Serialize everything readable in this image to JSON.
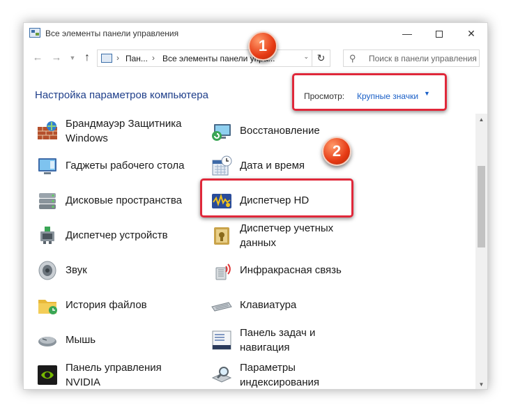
{
  "window": {
    "title": "Все элементы панели управления"
  },
  "nav": {
    "back_icon": "arrow-left-icon",
    "crumbs": [
      "Пан...",
      "Все элементы панели упра..."
    ],
    "search_placeholder": "Поиск в панели управления"
  },
  "header": {
    "title": "Настройка параметров компьютера",
    "view_label": "Просмотр:",
    "view_value": "Крупные значки"
  },
  "badges": [
    "1",
    "2"
  ],
  "items": [
    {
      "label1": "Брандмауэр Защитника",
      "label2": "Windows",
      "icon": "firewall-icon"
    },
    {
      "label1": "Восстановление",
      "label2": "",
      "icon": "recovery-icon"
    },
    {
      "label1": "Гаджеты рабочего стола",
      "label2": "",
      "icon": "gadgets-icon"
    },
    {
      "label1": "Дата и время",
      "label2": "",
      "icon": "date-time-icon"
    },
    {
      "label1": "Дисковые пространства",
      "label2": "",
      "icon": "storage-spaces-icon"
    },
    {
      "label1": "Диспетчер HD",
      "label2": "",
      "icon": "hd-audio-manager-icon"
    },
    {
      "label1": "Диспетчер устройств",
      "label2": "",
      "icon": "device-manager-icon"
    },
    {
      "label1": "Диспетчер учетных",
      "label2": "данных",
      "icon": "credential-manager-icon"
    },
    {
      "label1": "Звук",
      "label2": "",
      "icon": "speaker-icon"
    },
    {
      "label1": "Инфракрасная связь",
      "label2": "",
      "icon": "infrared-icon"
    },
    {
      "label1": "История файлов",
      "label2": "",
      "icon": "file-history-icon"
    },
    {
      "label1": "Клавиатура",
      "label2": "",
      "icon": "keyboard-icon"
    },
    {
      "label1": "Мышь",
      "label2": "",
      "icon": "mouse-icon"
    },
    {
      "label1": "Панель задач и",
      "label2": "навигация",
      "icon": "taskbar-icon"
    },
    {
      "label1": "Панель управления",
      "label2": "NVIDIA",
      "icon": "nvidia-icon"
    },
    {
      "label1": "Параметры",
      "label2": "индексирования",
      "icon": "indexing-icon"
    }
  ]
}
